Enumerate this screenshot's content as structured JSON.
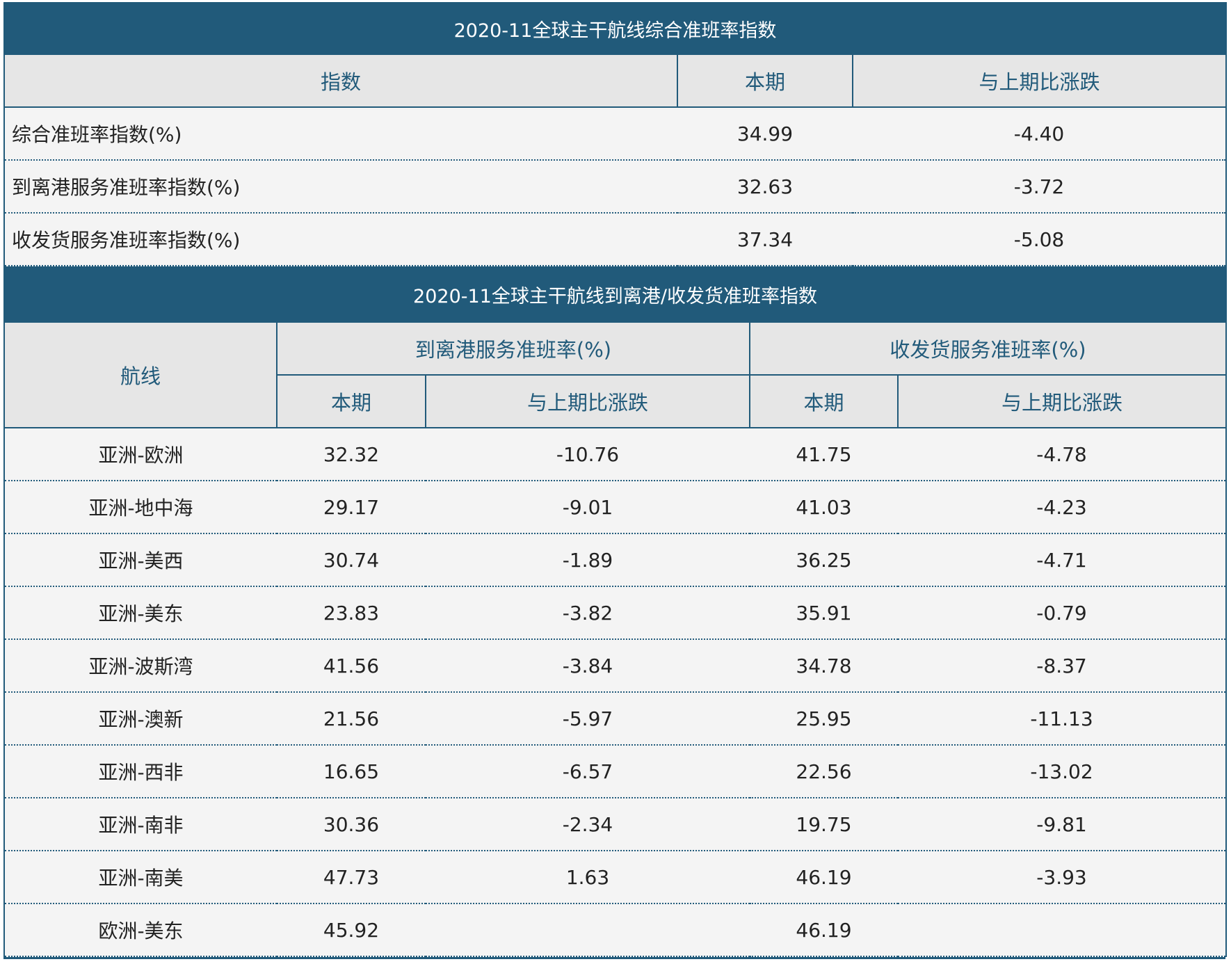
{
  "colors": {
    "header_bg": "#215a7a",
    "subheader_bg": "#e6e6e6",
    "header_text": "#215a7a",
    "row_bg": "#f4f4f4"
  },
  "summary": {
    "title": "2020-11全球主干航线综合准班率指数",
    "columns": [
      "指数",
      "本期",
      "与上期比涨跌"
    ],
    "rows": [
      {
        "name": "综合准班率指数(%)",
        "current": "34.99",
        "change": "-4.40"
      },
      {
        "name": "到离港服务准班率指数(%)",
        "current": "32.63",
        "change": "-3.72"
      },
      {
        "name": "收发货服务准班率指数(%)",
        "current": "37.34",
        "change": "-5.08"
      }
    ]
  },
  "routes": {
    "title": "2020-11全球主干航线到离港/收发货准班率指数",
    "route_header": "航线",
    "group_headers": [
      "到离港服务准班率(%)",
      "收发货服务准班率(%)"
    ],
    "sub_headers": [
      "本期",
      "与上期比涨跌",
      "本期",
      "与上期比涨跌"
    ],
    "rows": [
      {
        "route": "亚洲-欧洲",
        "port_current": "32.32",
        "port_change": "-10.76",
        "cargo_current": "41.75",
        "cargo_change": "-4.78"
      },
      {
        "route": "亚洲-地中海",
        "port_current": "29.17",
        "port_change": "-9.01",
        "cargo_current": "41.03",
        "cargo_change": "-4.23"
      },
      {
        "route": "亚洲-美西",
        "port_current": "30.74",
        "port_change": "-1.89",
        "cargo_current": "36.25",
        "cargo_change": "-4.71"
      },
      {
        "route": "亚洲-美东",
        "port_current": "23.83",
        "port_change": "-3.82",
        "cargo_current": "35.91",
        "cargo_change": "-0.79"
      },
      {
        "route": "亚洲-波斯湾",
        "port_current": "41.56",
        "port_change": "-3.84",
        "cargo_current": "34.78",
        "cargo_change": "-8.37"
      },
      {
        "route": "亚洲-澳新",
        "port_current": "21.56",
        "port_change": "-5.97",
        "cargo_current": "25.95",
        "cargo_change": "-11.13"
      },
      {
        "route": "亚洲-西非",
        "port_current": "16.65",
        "port_change": "-6.57",
        "cargo_current": "22.56",
        "cargo_change": "-13.02"
      },
      {
        "route": "亚洲-南非",
        "port_current": "30.36",
        "port_change": "-2.34",
        "cargo_current": "19.75",
        "cargo_change": "-9.81"
      },
      {
        "route": "亚洲-南美",
        "port_current": "47.73",
        "port_change": "1.63",
        "cargo_current": "46.19",
        "cargo_change": "-3.93"
      },
      {
        "route": "欧洲-美东",
        "port_current": "45.92",
        "port_change": "",
        "cargo_current": "46.19",
        "cargo_change": ""
      }
    ]
  }
}
